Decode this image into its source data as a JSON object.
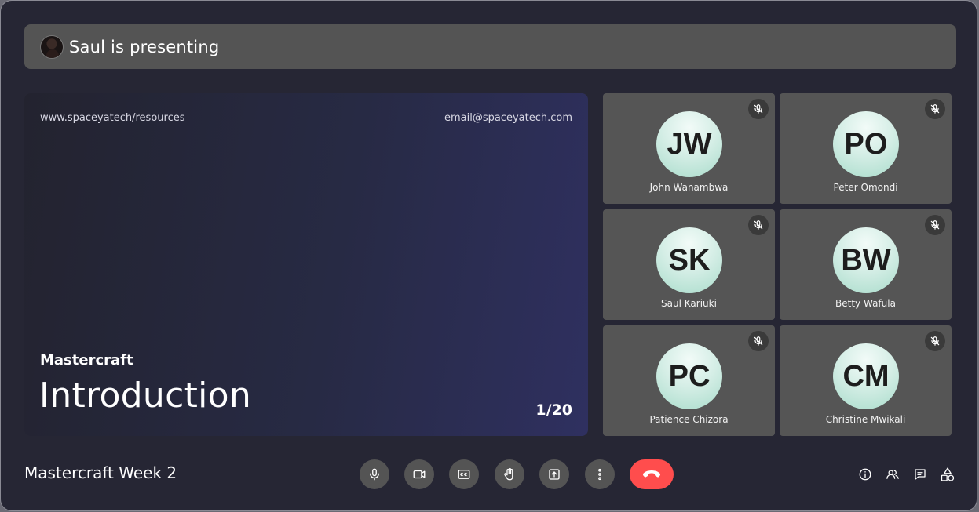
{
  "banner": {
    "text": "Saul is presenting",
    "avatar_icon": "presenter-avatar"
  },
  "slide": {
    "url": "www.spaceyatech/resources",
    "email": "email@spaceyatech.com",
    "subtitle": "Mastercraft",
    "title": "Introduction",
    "page": "1/20"
  },
  "participants": [
    {
      "initials": "JW",
      "name": "John Wanambwa",
      "muted": true
    },
    {
      "initials": "PO",
      "name": "Peter Omondi",
      "muted": true
    },
    {
      "initials": "SK",
      "name": "Saul Kariuki",
      "muted": true
    },
    {
      "initials": "BW",
      "name": "Betty Wafula",
      "muted": true
    },
    {
      "initials": "PC",
      "name": "Patience Chizora",
      "muted": true
    },
    {
      "initials": "CM",
      "name": "Christine Mwikali",
      "muted": true
    }
  ],
  "meeting": {
    "title": "Mastercraft Week 2"
  },
  "controls": [
    "microphone-icon",
    "camera-icon",
    "closed-captions-icon",
    "raise-hand-icon",
    "present-screen-icon",
    "more-options-icon",
    "end-call-icon"
  ],
  "side_controls": [
    "info-icon",
    "people-icon",
    "chat-icon",
    "activities-icon"
  ],
  "colors": {
    "background": "#262634",
    "tile": "#555555",
    "end_call": "#ff4d4d",
    "avatar": "#cfeee4"
  }
}
